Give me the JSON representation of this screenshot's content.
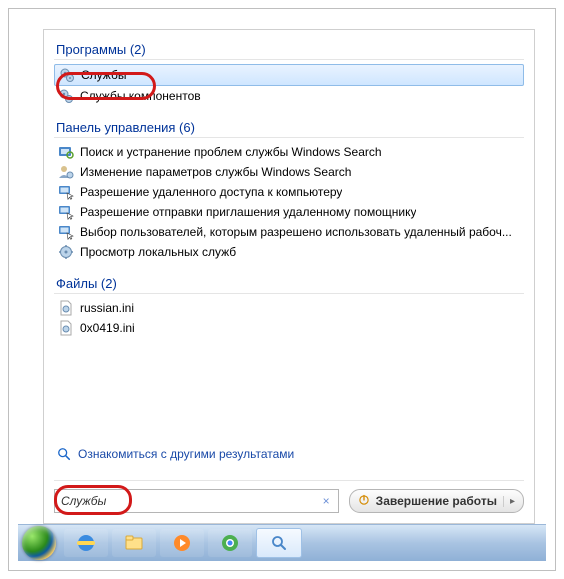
{
  "sections": [
    {
      "title": "Программы (2)",
      "items": [
        {
          "iconName": "gears-icon",
          "label": "Службы",
          "selected": true
        },
        {
          "iconName": "gears-icon",
          "label": "Службы компонентов"
        }
      ]
    },
    {
      "title": "Панель управления (6)",
      "items": [
        {
          "iconName": "troubleshoot-icon",
          "label": "Поиск и устранение проблем службы Windows Search"
        },
        {
          "iconName": "user-settings-icon",
          "label": "Изменение параметров службы Windows Search"
        },
        {
          "iconName": "remote-access-icon",
          "label": "Разрешение удаленного доступа к компьютеру"
        },
        {
          "iconName": "remote-invite-icon",
          "label": "Разрешение отправки приглашения удаленному помощнику"
        },
        {
          "iconName": "remote-users-icon",
          "label": "Выбор пользователей, которым разрешено использовать удаленный рабоч..."
        },
        {
          "iconName": "services-view-icon",
          "label": "Просмотр локальных служб"
        }
      ]
    },
    {
      "title": "Файлы (2)",
      "items": [
        {
          "iconName": "ini-file-icon",
          "label": "russian.ini"
        },
        {
          "iconName": "ini-file-icon",
          "label": "0x0419.ini"
        }
      ]
    }
  ],
  "seeMore": "Ознакомиться с другими результатами",
  "search": {
    "value": "Службы",
    "clear": "×"
  },
  "shutdownLabel": "Завершение работы"
}
